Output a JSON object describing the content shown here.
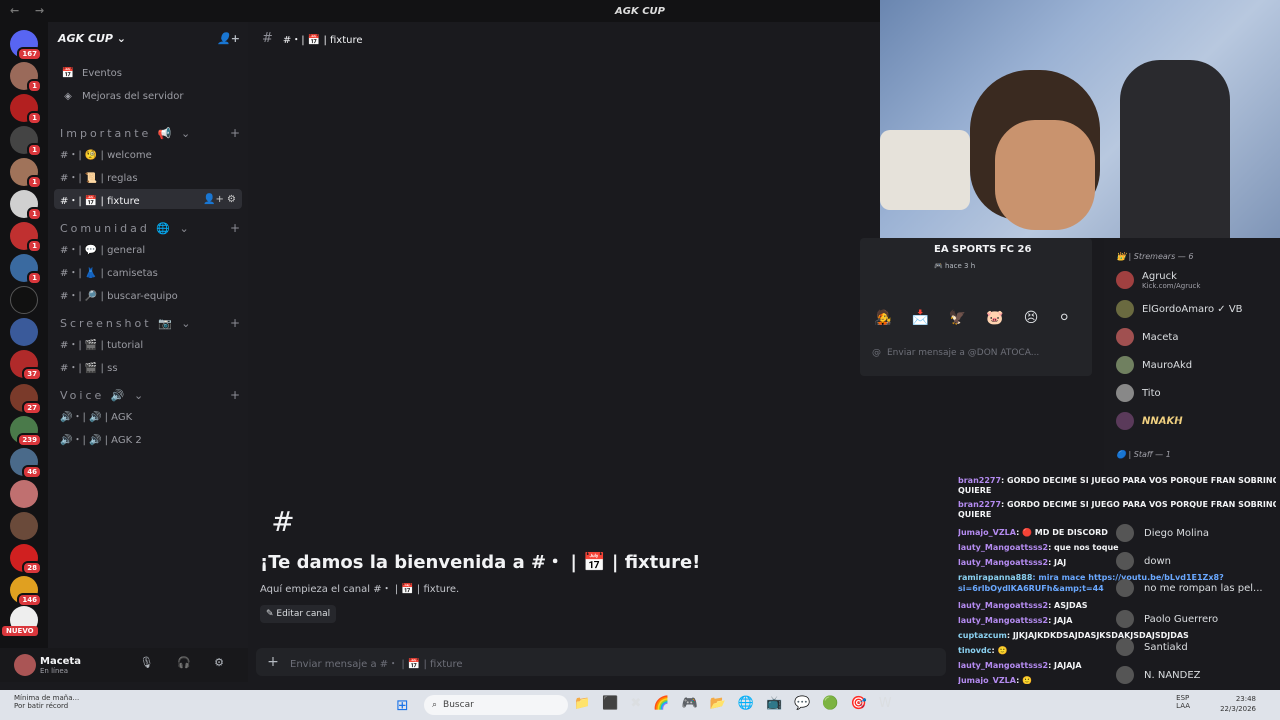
{
  "window": {
    "title": "AGK CUP"
  },
  "rail": {
    "badges": [
      "167",
      "1",
      "1",
      "1",
      "1",
      "1",
      "1",
      "1",
      "",
      "",
      "37",
      "27",
      "239",
      "46",
      "",
      "",
      "28",
      "146",
      ""
    ],
    "nuevo": "NUEVO"
  },
  "server": {
    "name": "AGK CUP ⌄"
  },
  "top_items": [
    {
      "icon": "calendar-icon",
      "label": "Eventos"
    },
    {
      "icon": "boost-icon",
      "label": "Mejoras del servidor"
    }
  ],
  "categories": {
    "importante": "Importante 📢 ⌄",
    "comunidad": "Comunidad 🌐 ⌄",
    "screenshot": "Screenshot 📷 ⌄",
    "voice": "Voice 🔊 ⌄"
  },
  "channels": {
    "welcome": "#・| 🧐 | welcome",
    "reglas": "#・| 📜 | reglas",
    "fixture": "#・| 📅 | fixture",
    "general": "#・| 💬 | general",
    "camisetas": "#・| 👗 | camisetas",
    "buscar": "#・| 🔎 | buscar-equipo",
    "tutorial": "#・| 🎬 | tutorial",
    "ss": "#・| 🎬 | ss",
    "agk": "🔊・| 🔊 | AGK",
    "agk2": "🔊・| 🔊 | AGK 2"
  },
  "user": {
    "name": "Maceta",
    "status": "En línea"
  },
  "main": {
    "header": "#・| 📅 | fixture",
    "welcome_title": "¡Te damos la bienvenida a #・ | 📅 | fixture!",
    "welcome_sub": "Aquí empieza el canal #・ | 📅 | fixture.",
    "edit": "✎ Editar canal",
    "composer_placeholder": "Enviar mensaje a #・ | 📅 | fixture"
  },
  "profile": {
    "game": "EA SPORTS FC 26",
    "ago": "🎮 hace 3 h",
    "emojis": [
      "🧑‍🎤",
      "📩",
      "🦅",
      "🐷",
      "😣",
      "⚪"
    ],
    "dm_placeholder": "Enviar mensaje a @DON ATOCA..."
  },
  "members": {
    "streamers_cat": "👑 | Stremears — 6",
    "list": [
      {
        "name": "Agruck",
        "sub": "Kick.com/Agruck",
        "color": "#f0d080"
      },
      {
        "name": "ElGordoAmaro ✓ VB",
        "sub": "",
        "color": "#f0d080"
      },
      {
        "name": "Maceta",
        "sub": "",
        "color": "#f0d080"
      },
      {
        "name": "MauroAkd",
        "sub": "",
        "color": "#f0d080"
      },
      {
        "name": "Tito",
        "sub": "",
        "color": "#f0d080"
      },
      {
        "name": "𝙉𝙉𝘼𝙆𝙃",
        "sub": "",
        "color": "#f0d080"
      }
    ],
    "staff_cat": "🔵 | Staff — 1"
  },
  "chat": [
    {
      "user": "bran2277",
      "msg": ": GORDO DECIME SI JUEGO PARA VOS PORQUE FRAN SOBRINO ME QUIERE"
    },
    {
      "user": "",
      "msg": "QUIERE"
    },
    {
      "user": "bran2277",
      "msg": ": GORDO DECIME SI JUEGO PARA VOS PORQUE FRAN SOBRINO ME"
    },
    {
      "user": "",
      "msg": "QUIERE"
    },
    {
      "user": "Jumajo_VZLA",
      "msg": ": 🔴 MD DE DISCORD"
    },
    {
      "user": "lauty_Mangoattsss2",
      "msg": ": que nos toque"
    },
    {
      "user": "lauty_Mangoattsss2",
      "msg": ": JAJ"
    },
    {
      "user": "ramirapanna888",
      "msg": ": mira mace https://youtu.be/bLvd1E1Zx8?"
    },
    {
      "user": "",
      "msg": "si=6rlbOydlKA6RUFh&amp;t=44"
    },
    {
      "user": "lauty_Mangoattsss2",
      "msg": ": ASJDAS"
    },
    {
      "user": "lauty_Mangoattsss2",
      "msg": ": JAJA"
    },
    {
      "user": "cuptazcum",
      "msg": ": JJKJAJKDKDSAJDASJKSDAKJSDAJSDJDAS"
    },
    {
      "user": "tinovdc",
      "msg": ": 🙂"
    },
    {
      "user": "lauty_Mangoattsss2",
      "msg": ": JAJAJA"
    },
    {
      "user": "Jumajo_VZLA",
      "msg": ": 🙂"
    },
    {
      "user": "tinovdc",
      "msg": ": 🙂"
    }
  ],
  "side_members": [
    {
      "name": "Diego Molina"
    },
    {
      "name": "down"
    },
    {
      "name": "no me rompan las pel..."
    },
    {
      "name": "Paolo Guerrero"
    },
    {
      "name": "Santiakd"
    },
    {
      "name": "N. NANDEZ"
    }
  ],
  "taskbar": {
    "weather_line1": "Mínima de maña...",
    "weather_line2": "Por batir récord",
    "search": "Buscar",
    "lang": "ESP\nLAA",
    "time": "23:48",
    "date": "22/3/2026",
    "apps": [
      "📁",
      "⬛",
      "✖",
      "🌈",
      "🎮",
      "📂",
      "🌐",
      "📺",
      "💬",
      "🟢",
      "🎯",
      "W"
    ]
  }
}
